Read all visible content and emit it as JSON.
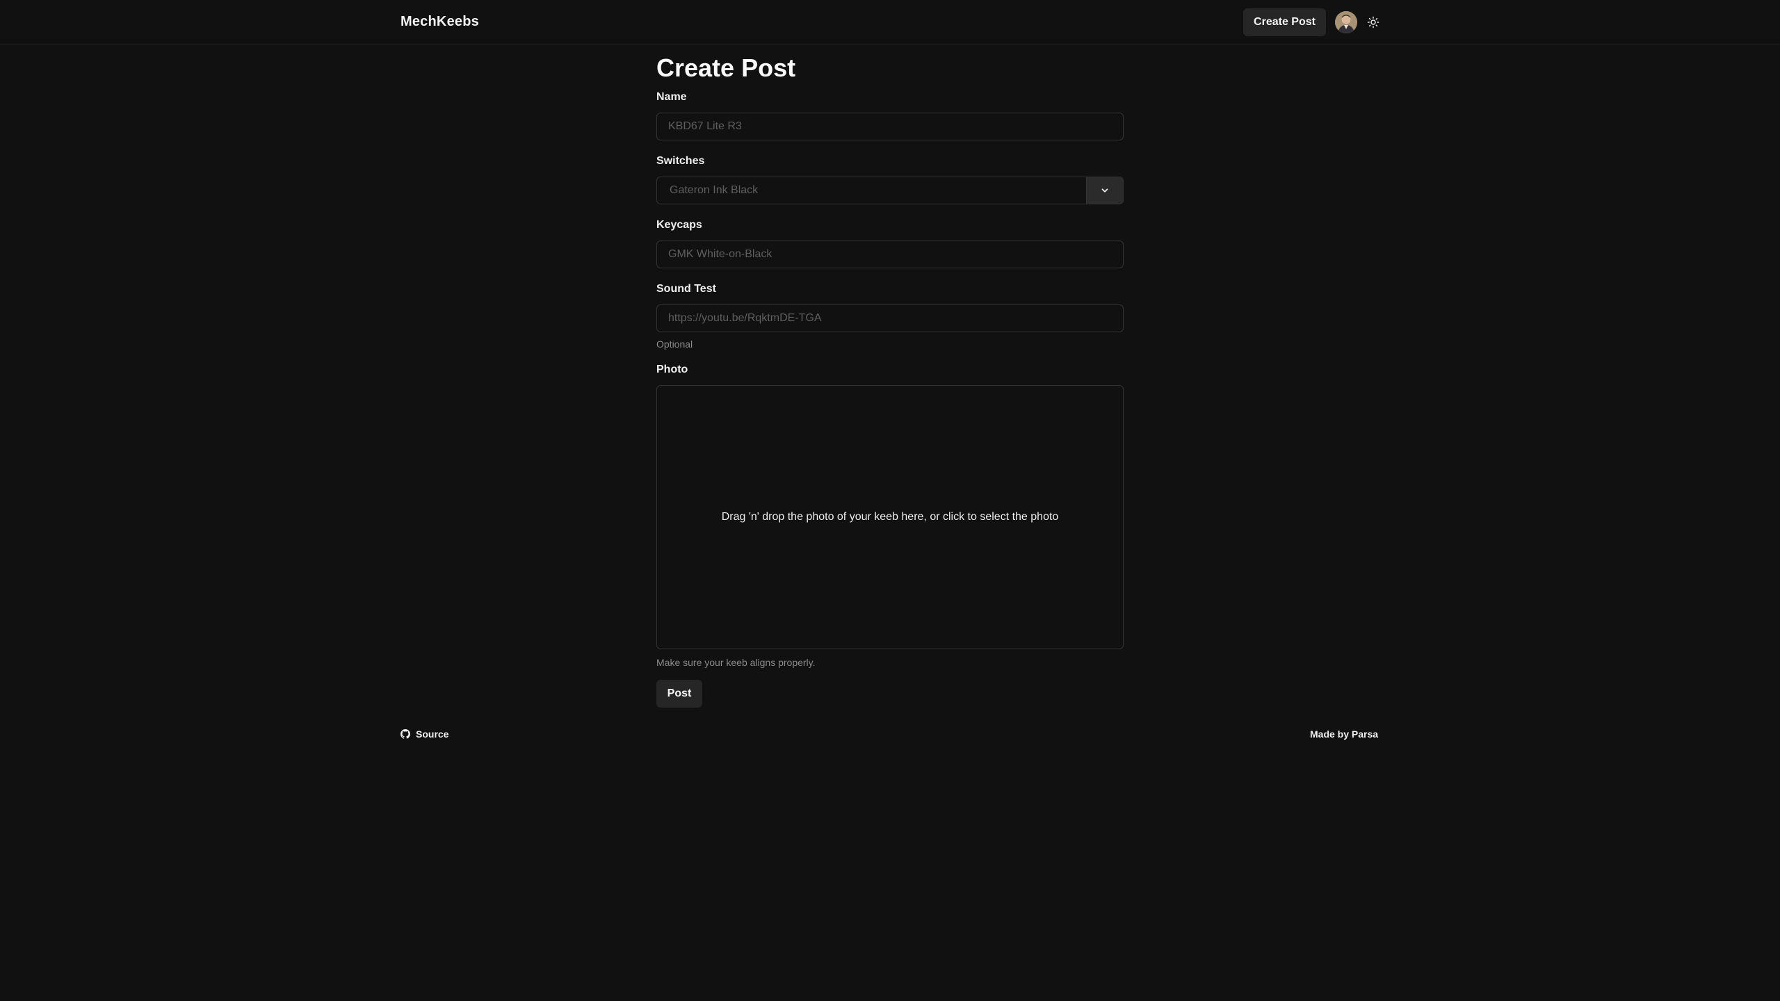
{
  "header": {
    "brand": "MechKeebs",
    "create_post_label": "Create Post",
    "avatar_icon": "user-avatar",
    "theme_icon": "sun-icon"
  },
  "form": {
    "title": "Create Post",
    "name": {
      "label": "Name",
      "placeholder": "KBD67 Lite R3"
    },
    "switches": {
      "label": "Switches",
      "placeholder": "Gateron Ink Black",
      "icon": "chevron-down-icon"
    },
    "keycaps": {
      "label": "Keycaps",
      "placeholder": "GMK White-on-Black"
    },
    "sound_test": {
      "label": "Sound Test",
      "placeholder": "https://youtu.be/RqktmDE-TGA",
      "helper": "Optional"
    },
    "photo": {
      "label": "Photo",
      "dropzone_text": "Drag 'n' drop the photo of your keeb here, or click to select the photo",
      "helper": "Make sure your keeb aligns properly."
    },
    "submit_label": "Post"
  },
  "footer": {
    "source_label": "Source",
    "source_icon": "github-icon",
    "credit": "Made by Parsa"
  },
  "colors": {
    "background": "#111111",
    "text": "#ededed",
    "muted": "#8a8a8a",
    "border": "#333333",
    "button": "#262626"
  }
}
